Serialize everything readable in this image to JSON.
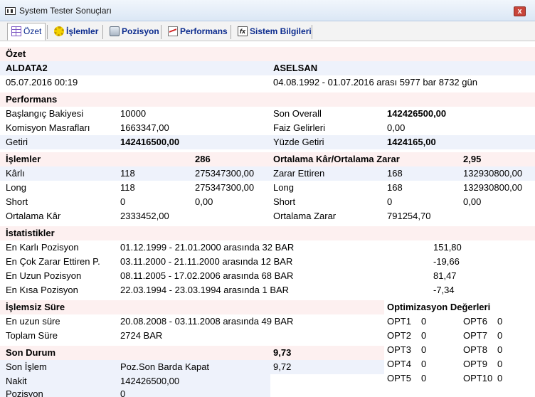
{
  "window": {
    "title": "System Tester Sonuçları",
    "close": "x"
  },
  "tabs": [
    {
      "label": "Özet"
    },
    {
      "label": "İşlemler"
    },
    {
      "label": "Pozisyon"
    },
    {
      "label": "Performans"
    },
    {
      "label": "Sistem Bilgileri"
    }
  ],
  "summary": {
    "header": "Özet",
    "system_name": "ALDATA2",
    "symbol": "ASELSAN",
    "run_time": "05.07.2016 00:19",
    "range": "04.08.1992 - 01.07.2016 arası 5977 bar 8732 gün"
  },
  "performance": {
    "header": "Performans",
    "start_balance_label": "Başlangıç Bakiyesi",
    "start_balance": "10000",
    "commission_label": "Komisyon Masrafları",
    "commission": "1663347,00",
    "return_label": "Getiri",
    "return": "142416500,00",
    "overall_label": "Son Overall",
    "overall": "142426500,00",
    "interest_label": "Faiz Gelirleri",
    "interest": "0,00",
    "pct_return_label": "Yüzde Getiri",
    "pct_return": "1424165,00"
  },
  "trades": {
    "header": "İşlemler",
    "count": "286",
    "avg_header": "Ortalama Kâr/Ortalama Zarar",
    "avg_ratio": "2,95",
    "profitable_label": "Kârlı",
    "profitable_count": "118",
    "profitable_value": "275347300,00",
    "long_label": "Long",
    "long_count": "118",
    "long_value": "275347300,00",
    "short_label": "Short",
    "short_count": "0",
    "short_value": "0,00",
    "avg_profit_label": "Ortalama Kâr",
    "avg_profit": "2333452,00",
    "losing_label": "Zarar Ettiren",
    "losing_count": "168",
    "losing_value": "132930800,00",
    "loss_long_label": "Long",
    "loss_long_count": "168",
    "loss_long_value": "132930800,00",
    "loss_short_label": "Short",
    "loss_short_count": "0",
    "loss_short_value": "0,00",
    "avg_loss_label": "Ortalama Zarar",
    "avg_loss": "791254,70"
  },
  "stats": {
    "header": "İstatistikler",
    "rows": [
      {
        "label": "En Karlı Pozisyon",
        "range": "01.12.1999 - 21.01.2000 arasında 32 BAR",
        "value": "151,80"
      },
      {
        "label": "En Çok Zarar Ettiren P.",
        "range": "03.11.2000 - 21.11.2000 arasında 12 BAR",
        "value": "-19,66"
      },
      {
        "label": "En Uzun Pozisyon",
        "range": "08.11.2005 - 17.02.2006 arasında 68 BAR",
        "value": "81,47"
      },
      {
        "label": "En Kısa Pozisyon",
        "range": "22.03.1994 - 23.03.1994 arasında 1 BAR",
        "value": "-7,34"
      }
    ]
  },
  "idle": {
    "header": "İşlemsiz Süre",
    "longest_label": "En uzun süre",
    "longest": "20.08.2008 - 03.11.2008 arasında 49 BAR",
    "total_label": "Toplam Süre",
    "total": "2724 BAR"
  },
  "optimization": {
    "header": "Optimizasyon Değerleri",
    "left": [
      {
        "name": "OPT1",
        "value": "0"
      },
      {
        "name": "OPT2",
        "value": "0"
      },
      {
        "name": "OPT3",
        "value": "0"
      },
      {
        "name": "OPT4",
        "value": "0"
      },
      {
        "name": "OPT5",
        "value": "0"
      }
    ],
    "right": [
      {
        "name": "OPT6",
        "value": "0"
      },
      {
        "name": "OPT7",
        "value": "0"
      },
      {
        "name": "OPT8",
        "value": "0"
      },
      {
        "name": "OPT9",
        "value": "0"
      },
      {
        "name": "OPT10",
        "value": "0"
      }
    ]
  },
  "status": {
    "header": "Son Durum",
    "header_value": "9,73",
    "last_trade_label": "Son İşlem",
    "last_trade": "Poz.Son Barda Kapat",
    "last_trade_value": "9,72",
    "cash_label": "Nakit",
    "cash": "142426500,00",
    "position_label": "Pozisyon",
    "position": "0"
  }
}
